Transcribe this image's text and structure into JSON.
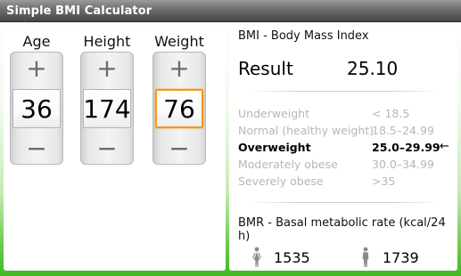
{
  "app": {
    "title": "Simple BMI Calculator"
  },
  "inputs": {
    "age": {
      "label": "Age",
      "value": "36",
      "plus": "+",
      "minus": "−"
    },
    "height": {
      "label": "Height",
      "value": "174",
      "plus": "+",
      "minus": "−"
    },
    "weight": {
      "label": "Weight",
      "value": "76",
      "plus": "+",
      "minus": "−",
      "focused": true
    }
  },
  "bmi": {
    "title": "BMI - Body Mass Index",
    "result_label": "Result",
    "result_value": "25.10",
    "categories": [
      {
        "name": "Underweight",
        "range": "< 18.5",
        "active": false
      },
      {
        "name": "Normal (healthy weight)",
        "range": "18.5–24.99",
        "active": false
      },
      {
        "name": "Overweight",
        "range": "25.0–29.99",
        "active": true,
        "marker": "←"
      },
      {
        "name": "Moderately obese",
        "range": "30.0–34.99",
        "active": false
      },
      {
        "name": "Severely obese",
        "range": ">35",
        "active": false
      }
    ]
  },
  "bmr": {
    "title": "BMR - Basal metabolic rate (kcal/24 h)",
    "female_icon": "female-figure-icon",
    "female_value": "1535",
    "male_icon": "male-figure-icon",
    "male_value": "1739"
  },
  "colors": {
    "focus_border": "#f39a1c",
    "background_gradient_bottom": "#3fb824",
    "inactive_text": "#b7b7b7"
  }
}
